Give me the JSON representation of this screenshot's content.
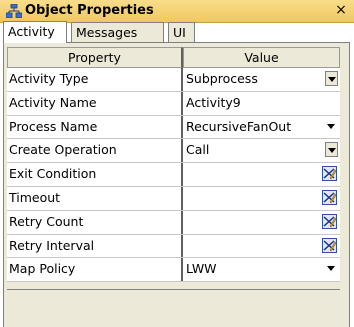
{
  "panel": {
    "title": "Object Properties",
    "close_label": "×"
  },
  "tabs": [
    {
      "label": "Activity",
      "active": true
    },
    {
      "label": "Messages",
      "active": false
    },
    {
      "label": "UI",
      "active": false
    }
  ],
  "table": {
    "headers": {
      "property": "Property",
      "value": "Value"
    },
    "rows": [
      {
        "property": "Activity Type",
        "value": "Subprocess",
        "control": "dropdown"
      },
      {
        "property": "Activity Name",
        "value": "Activity9",
        "control": "text"
      },
      {
        "property": "Process Name",
        "value": "RecursiveFanOut",
        "control": "dropdown-plain"
      },
      {
        "property": "Create Operation",
        "value": "Call",
        "control": "dropdown"
      },
      {
        "property": "Exit Condition",
        "value": "",
        "control": "edit-icon"
      },
      {
        "property": "Timeout",
        "value": "",
        "control": "edit-icon"
      },
      {
        "property": "Retry Count",
        "value": "",
        "control": "edit-icon"
      },
      {
        "property": "Retry Interval",
        "value": "",
        "control": "edit-icon"
      },
      {
        "property": "Map Policy",
        "value": "LWW",
        "control": "dropdown-plain"
      }
    ]
  },
  "icons": {
    "title": "object-hierarchy-icon",
    "edit": "edit-expression-icon",
    "dropdown": "chevron-down-icon"
  },
  "colors": {
    "titlebar": "#f0c860",
    "header_bg": "#ece9d8",
    "grid": "#c8c8c8"
  }
}
